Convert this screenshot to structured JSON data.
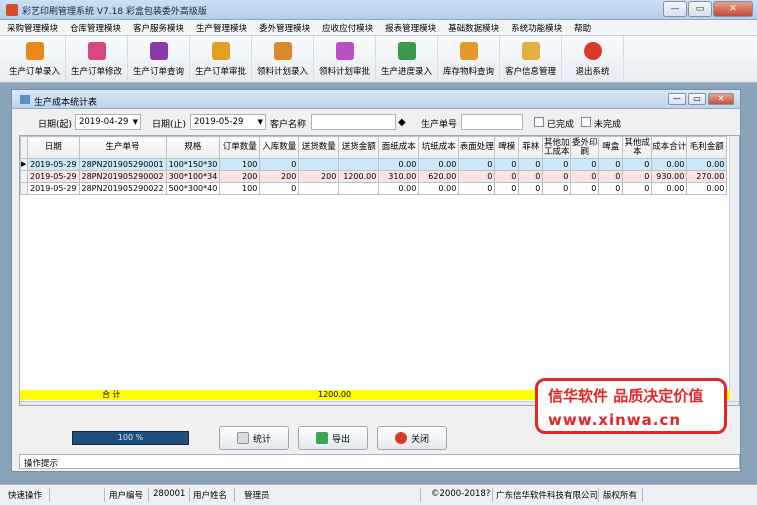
{
  "window": {
    "title": "彩艺印刷管理系统   V7.18 彩盒包装委外高级版",
    "min_label": "—",
    "max_label": "▭",
    "close_label": "✕"
  },
  "menu": [
    "采购管理模块",
    "仓库管理模块",
    "客户服务模块",
    "生产管理模块",
    "委外管理模块",
    "应收应付模块",
    "报表管理模块",
    "基础数据模块",
    "系统功能模块",
    "帮助"
  ],
  "toolbar": [
    {
      "label": "生产订单录入",
      "icon": "order-entry-icon",
      "color": "#e88a1a"
    },
    {
      "label": "生产订单修改",
      "icon": "order-edit-icon",
      "color": "#d6477a"
    },
    {
      "label": "生产订单查询",
      "icon": "order-query-icon",
      "color": "#8a3aa8"
    },
    {
      "label": "生产订单审批",
      "icon": "order-approve-icon",
      "color": "#e0a020"
    },
    {
      "label": "领料计划录入",
      "icon": "material-plan-entry-icon",
      "color": "#d98a2a"
    },
    {
      "label": "领料计划审批",
      "icon": "material-plan-approve-icon",
      "color": "#b84fc4"
    },
    {
      "label": "生产进度录入",
      "icon": "progress-entry-icon",
      "color": "#3a9a4a"
    },
    {
      "label": "库存物料查询",
      "icon": "inventory-query-icon",
      "color": "#e39a2c"
    },
    {
      "label": "客户信息管理",
      "icon": "customer-info-icon",
      "color": "#e0b040"
    },
    {
      "label": "退出系统",
      "icon": "exit-icon",
      "color": "#d83a2a"
    }
  ],
  "report": {
    "title": "生产成本统计表",
    "filters": {
      "date_from_label": "日期(起)",
      "date_from": "2019-04-29",
      "date_to_label": "日期(止)",
      "date_to": "2019-05-29",
      "customer_label": "客户名称",
      "customer_value": "",
      "order_no_label": "生产单号",
      "order_no_value": "",
      "completed_label": "已完成",
      "uncompleted_label": "未完成",
      "completed_checked": false,
      "uncompleted_checked": false
    },
    "columns": [
      "日期",
      "生产单号",
      "规格",
      "订单数量",
      "入库数量",
      "送货数量",
      "送货金额",
      "面纸成本",
      "坑纸成本",
      "表面处理",
      "啤模",
      "菲林",
      "其他加工成本",
      "委外印刷",
      "啤盒",
      "其他成本",
      "成本合计",
      "毛利金额"
    ],
    "rows": [
      {
        "date": "2019-05-29",
        "order_no": "28PN201905290001",
        "spec": "100*150*30",
        "order_qty": "100",
        "in_qty": "0",
        "ship_qty": "",
        "ship_amount": "",
        "face_paper": "0.00",
        "pit_paper": "0.00",
        "surface": "0",
        "die": "0",
        "film": "0",
        "other_proc": "0",
        "outsource_print": "0",
        "punch_box": "0",
        "other_cost": "0",
        "total_cost": "0.00",
        "gross_profit": "0.00"
      },
      {
        "date": "2019-05-29",
        "order_no": "28PN201905290002",
        "spec": "300*100*34",
        "order_qty": "200",
        "in_qty": "200",
        "ship_qty": "200",
        "ship_amount": "1200.00",
        "face_paper": "310.00",
        "pit_paper": "620.00",
        "surface": "0",
        "die": "0",
        "film": "0",
        "other_proc": "0",
        "outsource_print": "0",
        "punch_box": "0",
        "other_cost": "0",
        "total_cost": "930.00",
        "gross_profit": "270.00"
      },
      {
        "date": "2019-05-29",
        "order_no": "28PN201905290022",
        "spec": "500*300*40",
        "order_qty": "100",
        "in_qty": "0",
        "ship_qty": "",
        "ship_amount": "",
        "face_paper": "0.00",
        "pit_paper": "0.00",
        "surface": "0",
        "die": "0",
        "film": "0",
        "other_proc": "0",
        "outsource_print": "0",
        "punch_box": "0",
        "other_cost": "0",
        "total_cost": "0.00",
        "gross_profit": "0.00"
      }
    ],
    "summary": {
      "label": "合   计",
      "ship_amount": "1200.00"
    },
    "progress": {
      "text": "100 %",
      "value": 100
    },
    "buttons": {
      "stats": "统计",
      "export": "导出",
      "close": "关闭"
    },
    "hint_label": "操作提示"
  },
  "statusbar": {
    "quick_op": "快速操作",
    "user_no_label": "用户编号",
    "user_no": "280001",
    "user_name_label": "用户姓名",
    "user_name": "管理员",
    "copyright": "©2000-2018?",
    "company": "广东信华软件科技有限公司",
    "rights": "版权所有"
  },
  "watermark": {
    "line1": "信华软件 品质决定价值",
    "line2": "www.xinwa.cn"
  }
}
